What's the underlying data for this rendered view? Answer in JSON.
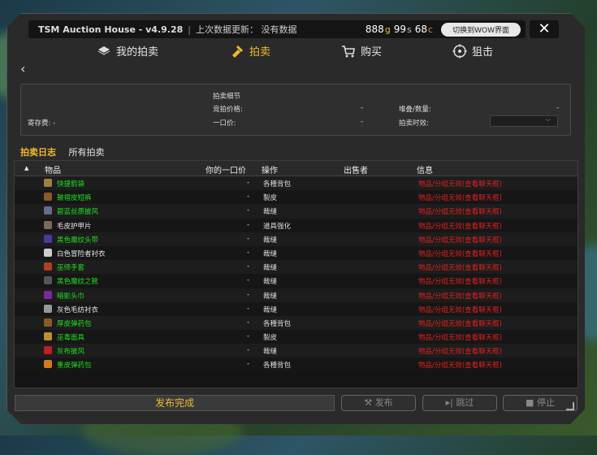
{
  "titlebar": {
    "title": "TSM Auction House - v4.9.28",
    "last_update": "上次数据更新： 没有数据",
    "gold": {
      "g": "888",
      "g_unit": "g",
      "s": "99",
      "s_unit": "s",
      "c": "68",
      "c_unit": "c"
    },
    "switch_button": "切换到WOW界面"
  },
  "close_label": "✕",
  "back_label": "‹",
  "tabs": [
    {
      "label": "我的拍卖",
      "icon": "folder-icon"
    },
    {
      "label": "拍卖",
      "icon": "gavel-icon",
      "active": true
    },
    {
      "label": "购买",
      "icon": "cart-icon"
    },
    {
      "label": "狙击",
      "icon": "crosshair-icon"
    }
  ],
  "details": {
    "header": "拍卖细节",
    "bid_label": "竞拍价格:",
    "bid_value": "-",
    "stack_label": "堆叠/数量:",
    "stack_value": "-",
    "deposit_label": "寄存费: -",
    "buyout_label": "一口价:",
    "buyout_value": "-",
    "duration_label": "拍卖时效:",
    "duration_value": "",
    "duration_dropdown_icon": "chevron-down-icon"
  },
  "log_tabs": {
    "active": "拍卖日志",
    "other": "所有拍卖"
  },
  "table": {
    "columns": {
      "sort": "▲",
      "item": "物品",
      "buyout": "你的一口价",
      "operation": "操作",
      "seller": "出售者",
      "info": "信息"
    },
    "rows": [
      {
        "item": "快捷箭袋",
        "buyout": "-",
        "operation": "各種背包",
        "info": "物品/分组无效(查看聊天框)",
        "color": "#1fdf1f",
        "icon_color": "#a08040"
      },
      {
        "item": "鞁褶皮短裤",
        "buyout": "-",
        "operation": "製皮",
        "info": "物品/分组无效(查看聊天框)",
        "color": "#1fdf1f",
        "icon_color": "#8a5a2a"
      },
      {
        "item": "碧蓝丝质披风",
        "buyout": "-",
        "operation": "裁缝",
        "info": "物品/分组无效(查看聊天框)",
        "color": "#1fdf1f",
        "icon_color": "#6a6a8a"
      },
      {
        "item": "毛皮护甲片",
        "buyout": "-",
        "operation": "道具强化",
        "info": "物品/分组无效(查看聊天框)",
        "color": "#e6e6e6",
        "icon_color": "#7a6a5a"
      },
      {
        "item": "黑色魔纹头带",
        "buyout": "-",
        "operation": "裁缝",
        "info": "物品/分组无效(查看聊天框)",
        "color": "#1fdf1f",
        "icon_color": "#4a3aa0"
      },
      {
        "item": "白色冒险者衬衣",
        "buyout": "-",
        "operation": "裁缝",
        "info": "物品/分组无效(查看聊天框)",
        "color": "#e6e6e6",
        "icon_color": "#cccccc"
      },
      {
        "item": "巫师手套",
        "buyout": "-",
        "operation": "裁缝",
        "info": "物品/分组无效(查看聊天框)",
        "color": "#1fdf1f",
        "icon_color": "#b04020"
      },
      {
        "item": "黑色魔纹之靴",
        "buyout": "-",
        "operation": "裁缝",
        "info": "物品/分组无效(查看聊天框)",
        "color": "#1fdf1f",
        "icon_color": "#555555"
      },
      {
        "item": "暗影头巾",
        "buyout": "-",
        "operation": "裁缝",
        "info": "物品/分组无效(查看聊天框)",
        "color": "#1fdf1f",
        "icon_color": "#7a2aa0"
      },
      {
        "item": "灰色毛纺衬衣",
        "buyout": "-",
        "operation": "裁缝",
        "info": "物品/分组无效(查看聊天框)",
        "color": "#e6e6e6",
        "icon_color": "#999999"
      },
      {
        "item": "厚皮弹药包",
        "buyout": "-",
        "operation": "各種背包",
        "info": "物品/分组无效(查看聊天框)",
        "color": "#1fdf1f",
        "icon_color": "#8a5a2a"
      },
      {
        "item": "巫毒面具",
        "buyout": "-",
        "operation": "製皮",
        "info": "物品/分组无效(查看聊天框)",
        "color": "#1fdf1f",
        "icon_color": "#c09030"
      },
      {
        "item": "灰布披风",
        "buyout": "-",
        "operation": "裁缝",
        "info": "物品/分组无效(查看聊天框)",
        "color": "#1fdf1f",
        "icon_color": "#c02020"
      },
      {
        "item": "重皮弹药包",
        "buyout": "-",
        "operation": "各種背包",
        "info": "物品/分组无效(查看聊天框)",
        "color": "#1fdf1f",
        "icon_color": "#d07a20"
      }
    ]
  },
  "footer": {
    "status": "发布完成",
    "post_button": "发布",
    "skip_button": "跳过",
    "stop_button": "停止"
  }
}
